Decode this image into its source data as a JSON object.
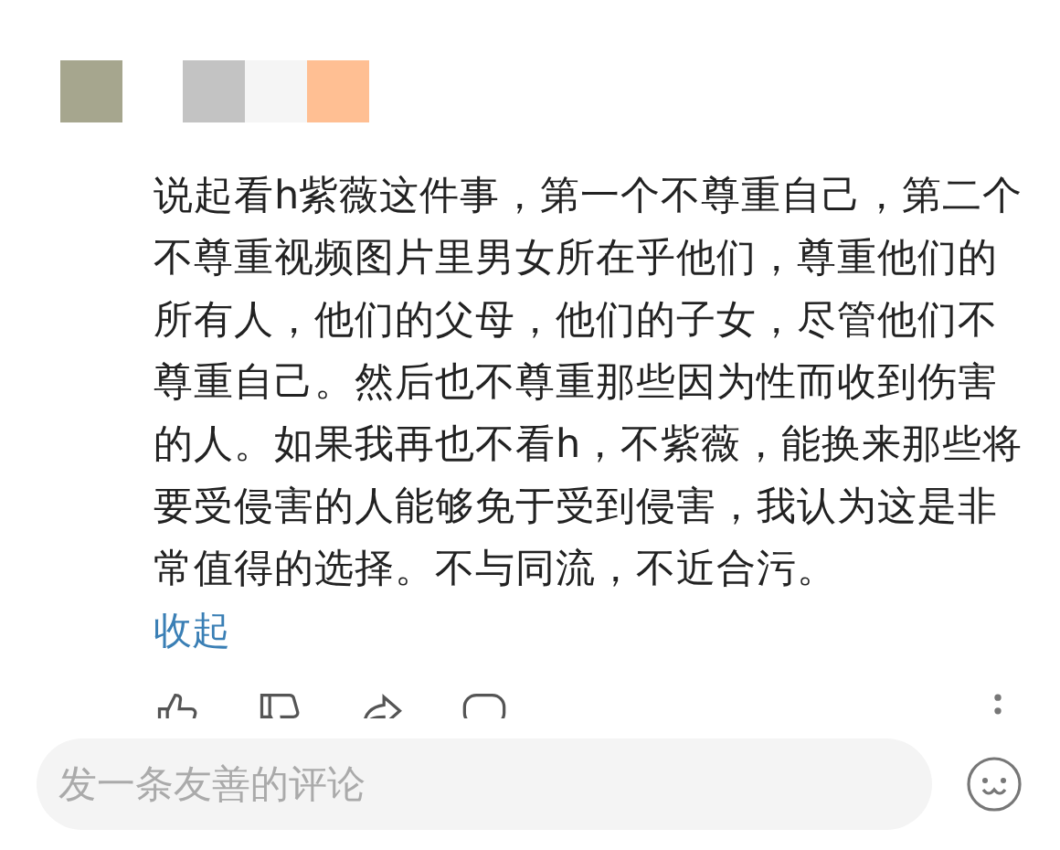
{
  "redaction_blocks": [
    {
      "color": "#a6a68e"
    },
    {
      "color": "#c3c3c3"
    },
    {
      "color": "#f5f5f5"
    },
    {
      "color": "#ffbf93"
    }
  ],
  "comment": {
    "lines": [
      "说起看h紫薇这件事，第一个不尊重自己，第二个",
      "不尊重视频图片里男女所在乎他们，尊重他们的",
      "所有人，他们的父母，他们的子女，尽管他们不",
      "尊重自己。然后也不尊重那些因为性而收到伤害",
      "的人。如果我再也不看h，不紫薇，能换来那些将",
      "要受侵害的人能够免于受到侵害，我认为这是非",
      "常值得的选择。不与同流，不近合污。"
    ],
    "collapse_link": "收起"
  },
  "reply_bar": {
    "placeholder": "发一条友善的评论"
  }
}
